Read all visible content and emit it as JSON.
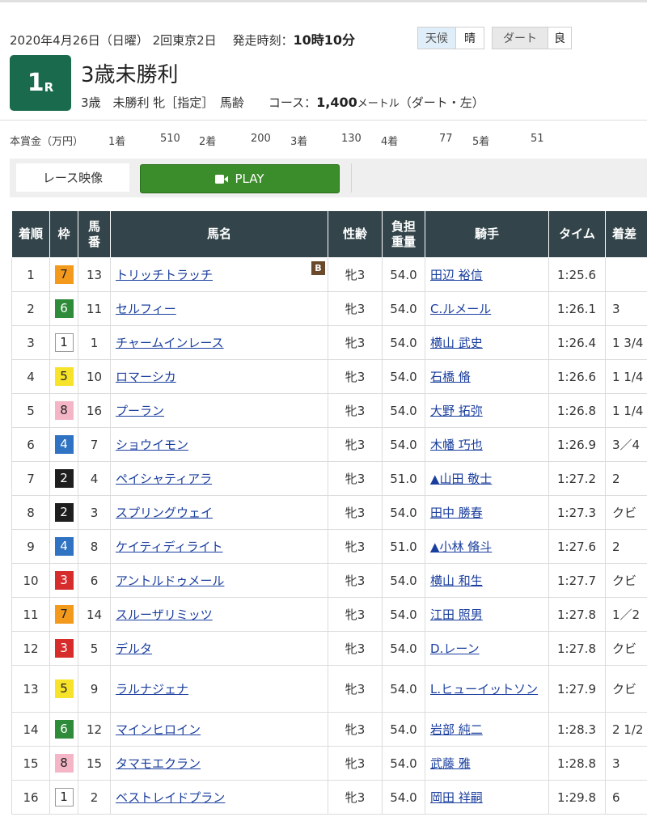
{
  "race": {
    "date": "2020年4月26日（日曜）",
    "meeting": "2回東京2日",
    "start_label": "発走時刻：",
    "start_time": "10時10分",
    "weather_label": "天候",
    "weather": "晴",
    "surface_label": "ダート",
    "track_cond": "良",
    "number": "1",
    "number_suffix": "R",
    "name": "3歳未勝利",
    "conditions": "3歳　未勝利 牝［指定］　馬齢",
    "course_label": "コース：",
    "distance": "1,400",
    "distance_unit": "メートル",
    "course_detail": "（ダート・左）"
  },
  "prize": {
    "label": "本賞金（万円）",
    "places": [
      {
        "place": "1着",
        "amount": "510"
      },
      {
        "place": "2着",
        "amount": "200"
      },
      {
        "place": "3着",
        "amount": "130"
      },
      {
        "place": "4着",
        "amount": "77"
      },
      {
        "place": "5着",
        "amount": "51"
      }
    ]
  },
  "video": {
    "label": "レース映像",
    "play": "PLAY"
  },
  "colors": {
    "badge": "#1a6b4e",
    "header_bg": "#33454a",
    "play": "#3b8c2a",
    "link": "#1a3e9e"
  },
  "table": {
    "headers": {
      "rank": "着順",
      "waku": "枠",
      "num_a": "馬",
      "num_b": "番",
      "horse": "馬名",
      "sexage": "性齢",
      "weight_a": "負担",
      "weight_b": "重量",
      "jockey": "騎手",
      "time": "タイム",
      "margin": "着差"
    },
    "rows": [
      {
        "rank": "1",
        "waku": "7",
        "num": "13",
        "horse": "トリッチトラッチ",
        "blinker": "B",
        "sexage": "牝3",
        "weight": "54.0",
        "jockey": "田辺 裕信",
        "time": "1:25.6",
        "margin": ""
      },
      {
        "rank": "2",
        "waku": "6",
        "num": "11",
        "horse": "セルフィー",
        "blinker": "",
        "sexage": "牝3",
        "weight": "54.0",
        "jockey": "C.ルメール",
        "time": "1:26.1",
        "margin": "3"
      },
      {
        "rank": "3",
        "waku": "1",
        "num": "1",
        "horse": "チャームインレース",
        "blinker": "",
        "sexage": "牝3",
        "weight": "54.0",
        "jockey": "横山 武史",
        "time": "1:26.4",
        "margin": "1 3/4"
      },
      {
        "rank": "4",
        "waku": "5",
        "num": "10",
        "horse": "ロマーシカ",
        "blinker": "",
        "sexage": "牝3",
        "weight": "54.0",
        "jockey": "石橋 脩",
        "time": "1:26.6",
        "margin": "1 1/4"
      },
      {
        "rank": "5",
        "waku": "8",
        "num": "16",
        "horse": "プーラン",
        "blinker": "",
        "sexage": "牝3",
        "weight": "54.0",
        "jockey": "大野 拓弥",
        "time": "1:26.8",
        "margin": "1 1/4"
      },
      {
        "rank": "6",
        "waku": "4",
        "num": "7",
        "horse": "ショウイモン",
        "blinker": "",
        "sexage": "牝3",
        "weight": "54.0",
        "jockey": "木幡 巧也",
        "time": "1:26.9",
        "margin": "3／4"
      },
      {
        "rank": "7",
        "waku": "2",
        "num": "4",
        "horse": "ペイシャティアラ",
        "blinker": "",
        "sexage": "牝3",
        "weight": "51.0",
        "jockey": "▲山田 敬士",
        "time": "1:27.2",
        "margin": "2"
      },
      {
        "rank": "8",
        "waku": "2",
        "num": "3",
        "horse": "スプリングウェイ",
        "blinker": "",
        "sexage": "牝3",
        "weight": "54.0",
        "jockey": "田中 勝春",
        "time": "1:27.3",
        "margin": "クビ"
      },
      {
        "rank": "9",
        "waku": "4",
        "num": "8",
        "horse": "ケイティディライト",
        "blinker": "",
        "sexage": "牝3",
        "weight": "51.0",
        "jockey": "▲小林 脩斗",
        "time": "1:27.6",
        "margin": "2"
      },
      {
        "rank": "10",
        "waku": "3",
        "num": "6",
        "horse": "アントルドゥメール",
        "blinker": "",
        "sexage": "牝3",
        "weight": "54.0",
        "jockey": "横山 和生",
        "time": "1:27.7",
        "margin": "クビ"
      },
      {
        "rank": "11",
        "waku": "7",
        "num": "14",
        "horse": "スルーザリミッツ",
        "blinker": "",
        "sexage": "牝3",
        "weight": "54.0",
        "jockey": "江田 照男",
        "time": "1:27.8",
        "margin": "1／2"
      },
      {
        "rank": "12",
        "waku": "3",
        "num": "5",
        "horse": "デルタ",
        "blinker": "",
        "sexage": "牝3",
        "weight": "54.0",
        "jockey": "D.レーン",
        "time": "1:27.8",
        "margin": "クビ"
      },
      {
        "rank": "13",
        "waku": "5",
        "num": "9",
        "horse": "ラルナジェナ",
        "blinker": "",
        "sexage": "牝3",
        "weight": "54.0",
        "jockey": "L.ヒューイットソン",
        "time": "1:27.9",
        "margin": "クビ"
      },
      {
        "rank": "14",
        "waku": "6",
        "num": "12",
        "horse": "マインヒロイン",
        "blinker": "",
        "sexage": "牝3",
        "weight": "54.0",
        "jockey": "岩部 純二",
        "time": "1:28.3",
        "margin": "2 1/2"
      },
      {
        "rank": "15",
        "waku": "8",
        "num": "15",
        "horse": "タマモエクラン",
        "blinker": "",
        "sexage": "牝3",
        "weight": "54.0",
        "jockey": "武藤 雅",
        "time": "1:28.8",
        "margin": "3"
      },
      {
        "rank": "16",
        "waku": "1",
        "num": "2",
        "horse": "ベストレイドプラン",
        "blinker": "",
        "sexage": "牝3",
        "weight": "54.0",
        "jockey": "岡田 祥嗣",
        "time": "1:29.8",
        "margin": "6"
      }
    ]
  }
}
